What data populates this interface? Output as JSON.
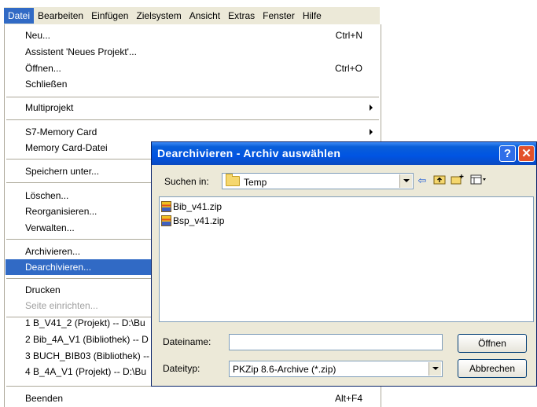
{
  "menubar": {
    "items": [
      "Datei",
      "Bearbeiten",
      "Einfügen",
      "Zielsystem",
      "Ansicht",
      "Extras",
      "Fenster",
      "Hilfe"
    ]
  },
  "file_menu": {
    "items": {
      "neu": {
        "label": "Neu...",
        "shortcut": "Ctrl+N"
      },
      "assistent": {
        "label": "Assistent 'Neues Projekt'..."
      },
      "oeffnen": {
        "label": "Öffnen...",
        "shortcut": "Ctrl+O"
      },
      "schliessen": {
        "label": "Schließen"
      },
      "multiprojekt": {
        "label": "Multiprojekt"
      },
      "memory_card": {
        "label": "S7-Memory Card"
      },
      "memory_card_datei": {
        "label": "Memory Card-Datei"
      },
      "speichern_unter": {
        "label": "Speichern unter..."
      },
      "loeschen": {
        "label": "Löschen..."
      },
      "reorganisieren": {
        "label": "Reorganisieren..."
      },
      "verwalten": {
        "label": "Verwalten..."
      },
      "archivieren": {
        "label": "Archivieren..."
      },
      "dearchivieren": {
        "label": "Dearchivieren..."
      },
      "drucken": {
        "label": "Drucken"
      },
      "seite_einrichten": {
        "label": "Seite einrichten..."
      },
      "recent1": {
        "label": "1 B_V41_2 (Projekt) -- D:\\Bu"
      },
      "recent2": {
        "label": "2 Bib_4A_V1 (Bibliothek) -- D"
      },
      "recent3": {
        "label": "3 BUCH_BIB03 (Bibliothek) --"
      },
      "recent4": {
        "label": "4 B_4A_V1 (Projekt) -- D:\\Bu"
      },
      "beenden": {
        "label": "Beenden",
        "shortcut": "Alt+F4"
      }
    }
  },
  "dialog": {
    "title": "Dearchivieren - Archiv auswählen",
    "help_glyph": "?",
    "close_glyph": "✕",
    "look_in_label": "Suchen in:",
    "look_in_value": "Temp",
    "files": [
      "Bib_v41.zip",
      "Bsp_v41.zip"
    ],
    "filename_label": "Dateiname:",
    "filename_value": "",
    "filetype_label": "Dateityp:",
    "filetype_value": "PKZip 8.6-Archive (*.zip)",
    "open_button": "Öffnen",
    "cancel_button": "Abbrechen",
    "toolbar_icons": [
      "back-icon",
      "up-folder-icon",
      "new-folder-icon",
      "view-menu-icon"
    ]
  },
  "colors": {
    "highlight": "#316ac5",
    "titlebar": "#0054e3",
    "face": "#ece9d8"
  }
}
